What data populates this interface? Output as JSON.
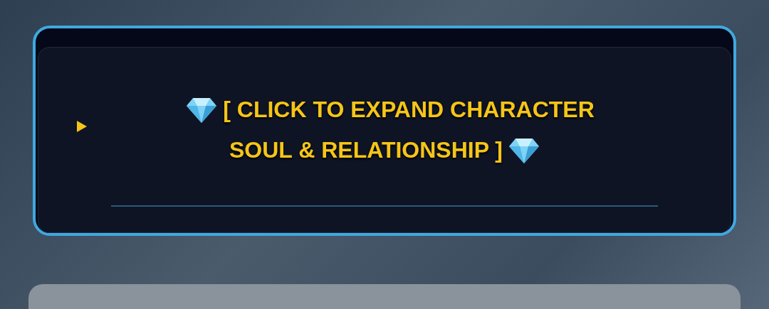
{
  "disclosure": {
    "expanded": false,
    "summary_lines": [
      "[ CLICK TO EXPAND CHARACTER",
      "SOUL & RELATIONSHIP ]"
    ]
  }
}
